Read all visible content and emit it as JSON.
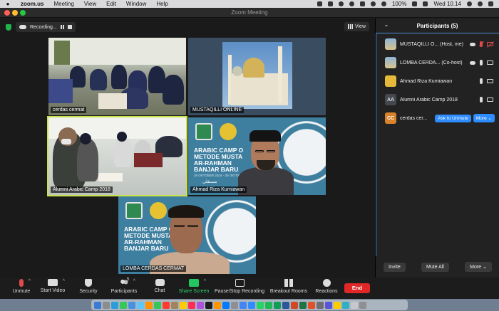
{
  "menubar": {
    "app": "zoom.us",
    "items": [
      "Meeting",
      "View",
      "Edit",
      "Window",
      "Help"
    ],
    "battery": "100%",
    "clock": "Wed 10.14"
  },
  "window": {
    "title": "Zoom Meeting"
  },
  "topbar": {
    "recording_label": "Recording...",
    "view_label": "View"
  },
  "tiles": [
    {
      "name": "cerdas cermat"
    },
    {
      "name": "MUSTAQILLI ONLINE"
    },
    {
      "name": "Alumni Arabic Camp 2018"
    },
    {
      "name": "Ahmad Riza Kurniawan"
    },
    {
      "name": "LOMBA CERDAS CERMAT"
    }
  ],
  "banner": {
    "title_lines": [
      "ARABIC CAMP O",
      "METODE MUSTA",
      "AR-RAHMAN",
      "BANJAR BARU"
    ],
    "title_lines_small": [
      "ARABIC CAMP C",
      "METODE MUSTA",
      "AR-RAHMAN",
      "BANJAR BARU"
    ],
    "subtitle": "25 OKTOBER 2024 - 29 OKTOBER",
    "arabic": "مستقلي"
  },
  "participants": {
    "title": "Participants (5)",
    "list": [
      {
        "name": "MUSTAQILLI O... (Host, me)",
        "avatar": "img"
      },
      {
        "name": "LOMBA CERDA... (Co-host)",
        "avatar": "img"
      },
      {
        "name": "Ahmad Riza Kurniawan",
        "avatar": "gold"
      },
      {
        "name": "Alumni Arabic Camp 2018",
        "avatar": "AA"
      },
      {
        "name": "cerdas cer...",
        "avatar": "CC",
        "ask_label": "Ask to Unmute",
        "more_label": "More"
      }
    ],
    "footer": {
      "invite": "Invite",
      "mute_all": "Mute All",
      "more": "More"
    }
  },
  "toolbar": {
    "unmute": "Unmute",
    "start_video": "Start Video",
    "security": "Security",
    "participants": "Participants",
    "participants_count": "5",
    "chat": "Chat",
    "share_screen": "Share Screen",
    "record": "Pause/Stop Recording",
    "breakout": "Breakout Rooms",
    "reactions": "Reactions",
    "end": "End"
  },
  "colors": {
    "accent": "#2d8cff",
    "end": "#e02828",
    "share": "#23c55e",
    "active_speaker": "#c8e34a"
  }
}
